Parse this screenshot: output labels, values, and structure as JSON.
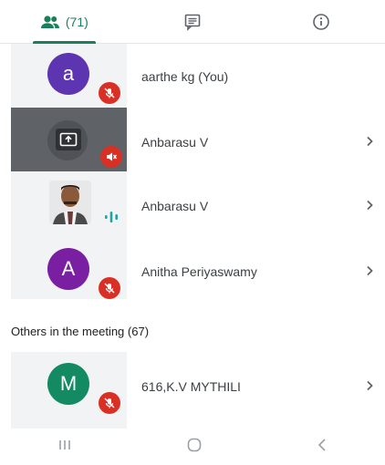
{
  "tabs": {
    "people_count": "(71)"
  },
  "participants": [
    {
      "initial": "a",
      "name": "aarthe kg (You)",
      "avatar_color": "#5e35b1"
    },
    {
      "name": "Anbarasu V"
    },
    {
      "name": "Anbarasu V"
    },
    {
      "initial": "A",
      "name": "Anitha Periyaswamy",
      "avatar_color": "#7b1fa2"
    }
  ],
  "others": {
    "title": "Others in the meeting (67)",
    "items": [
      {
        "initial": "M",
        "name": "616,K.V MYTHILI",
        "avatar_color": "#138a62"
      }
    ]
  },
  "colors": {
    "accent": "#1a7f5a",
    "mute": "#d93025",
    "tile": "#f1f3f4",
    "tile_dark": "#5f6368"
  },
  "icons": {
    "people_tab": "people-icon",
    "chat_tab": "chat-icon",
    "info_tab": "info-icon",
    "presenting": "present-screen-icon",
    "mic_off": "mic-off-icon",
    "speaker_off": "speaker-off-icon",
    "speaking": "audio-level-icon",
    "chevron": "chevron-right-icon",
    "nav_recents": "recents-icon",
    "nav_home": "home-icon",
    "nav_back": "back-icon"
  }
}
